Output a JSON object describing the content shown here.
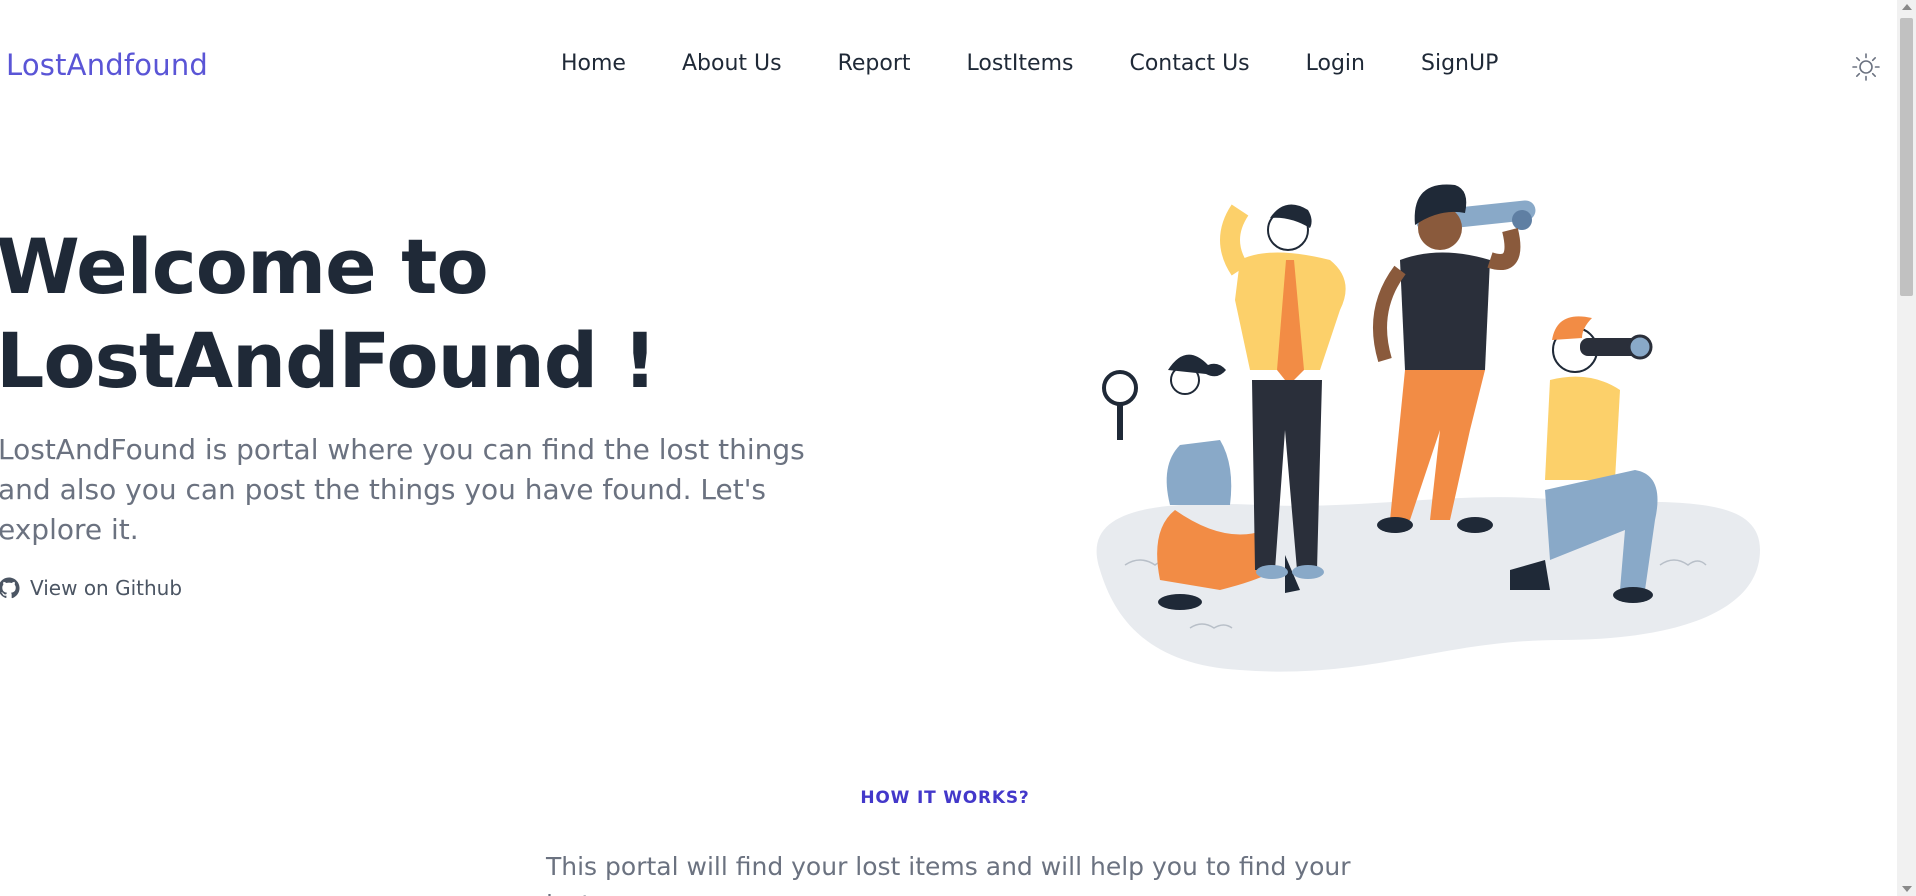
{
  "header": {
    "brand": "LostAndfound",
    "nav": [
      {
        "label": "Home"
      },
      {
        "label": "About Us"
      },
      {
        "label": "Report"
      },
      {
        "label": "LostItems"
      },
      {
        "label": "Contact Us"
      },
      {
        "label": "Login"
      },
      {
        "label": "SignUP"
      }
    ],
    "theme_icon": "sun-icon"
  },
  "hero": {
    "title_line1": "Welcome to",
    "title_line2": "LostAndFound !",
    "description": "LostAndFound is portal where you can find the lost things and also you can post the things you have found. Let's explore it.",
    "github_link": "View on Github",
    "github_icon": "github-icon",
    "illustration": "people-searching-illustration"
  },
  "how_it_works": {
    "heading": "HOW IT WORKS?",
    "description": "This portal will find your lost items and will help you to find your lost"
  },
  "colors": {
    "brand": "#5a55d6",
    "heading": "#1f2937",
    "muted": "#6b7280",
    "accent": "#4338ca"
  }
}
